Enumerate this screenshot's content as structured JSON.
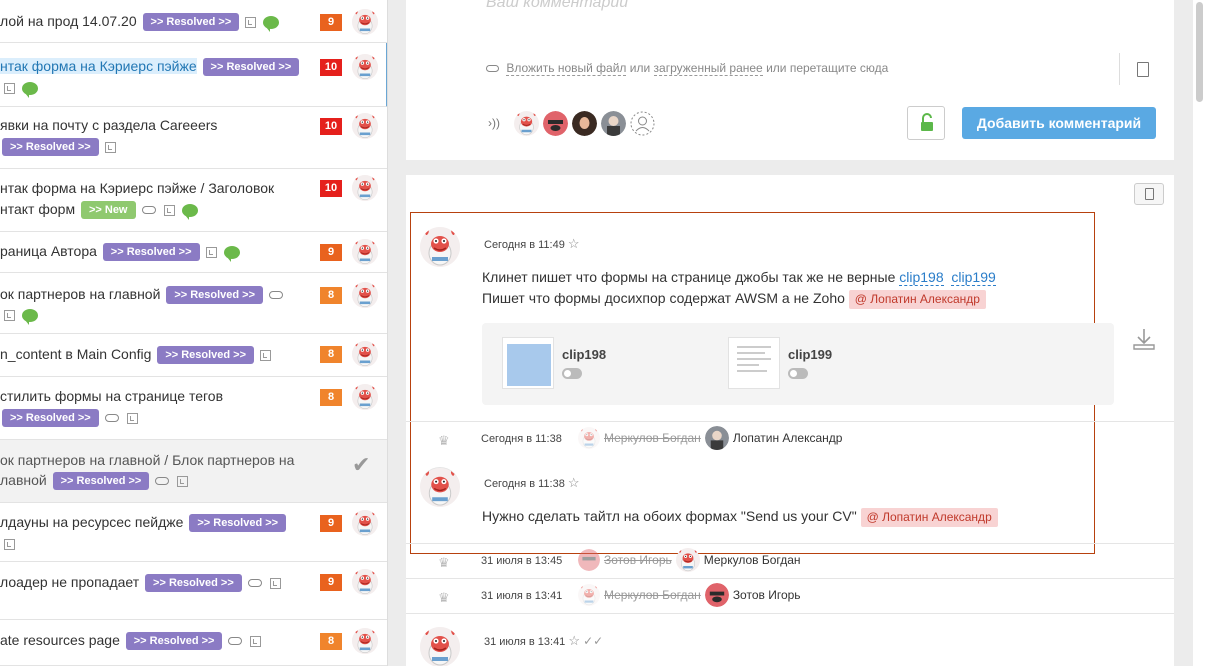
{
  "tasks": [
    {
      "title": "лой на прод 14.07.20",
      "badge": ">> Resolved >>",
      "prio": "9",
      "prio_color": "#e9621e"
    },
    {
      "title": "нтак форма на Кэриерс пэйже",
      "badge": ">> Resolved >>",
      "prio": "10",
      "prio_color": "#e5201c"
    },
    {
      "title": "явки на почту с раздела Careeers",
      "badge": ">> Resolved >>",
      "prio": "10",
      "prio_color": "#e5201c"
    },
    {
      "title": "нтак форма на Кэриерс пэйже / Заголовок",
      "title2": "нтакт форм",
      "badge": ">> New",
      "prio": "10",
      "prio_color": "#e5201c"
    },
    {
      "title": "раница Автора",
      "badge": ">> Resolved >>",
      "prio": "9",
      "prio_color": "#e9621e"
    },
    {
      "title": "ок партнеров на главной",
      "badge": ">> Resolved >>",
      "prio": "8",
      "prio_color": "#f0842c"
    },
    {
      "title": "n_content в Main Config",
      "badge": ">> Resolved >>",
      "prio": "8",
      "prio_color": "#f0842c"
    },
    {
      "title": "стилить формы на странице тегов",
      "badge": ">> Resolved >>",
      "prio": "8",
      "prio_color": "#f0842c"
    },
    {
      "title": "ок партнеров на главной / Блок партнеров на",
      "title2": "лавной",
      "badge": ">> Resolved >>"
    },
    {
      "title": "лдауны на ресурсес пейдже",
      "badge": ">> Resolved >>",
      "prio": "9",
      "prio_color": "#e9621e"
    },
    {
      "title": "лоадер не пропадает",
      "badge": ">> Resolved >>",
      "prio": "9",
      "prio_color": "#e9621e"
    },
    {
      "title": "ate resources page",
      "badge": ">> Resolved >>",
      "prio": "8",
      "prio_color": "#f0842c"
    }
  ],
  "composer": {
    "placeholder": "Ваш комментарий",
    "attach_new": "Вложить новый файл",
    "or1": "или",
    "attach_prev": "загруженный ранее",
    "or2": "или",
    "drag": "перетащите сюда",
    "submit": "Добавить комментарий"
  },
  "comments": [
    {
      "time": "Сегодня в 11:49",
      "line1": "Клинет пишет что формы на странице джобы так же не верные",
      "link1": "clip198",
      "link2": "clip199",
      "line2": "Пишет что формы досихпор содержат  AWSM  а не Zoho",
      "mention": "@ Лопатин Александр",
      "files": [
        "clip198",
        "clip199"
      ]
    },
    {
      "time": "Сегодня в 11:38",
      "text": "Нужно сделать тайтл на обоих формах \"Send us your CV\"",
      "mention": "@ Лопатин Александр"
    },
    {
      "time": "31 июля в 13:41"
    }
  ],
  "history": [
    {
      "time": "Сегодня в 11:38",
      "from": "Меркулов Богдан",
      "to": "Лопатин Александр"
    },
    {
      "time": "31 июля в 13:45",
      "from": "Зотов Игорь",
      "to": "Меркулов Богдан"
    },
    {
      "time": "31 июля в 13:41",
      "from": "Меркулов Богдан",
      "to": "Зотов Игорь"
    }
  ],
  "colors": {
    "accent": "#5aa9e3",
    "resolved": "#8b7bc4",
    "new": "#8fc96f",
    "highlight_border": "#b7410e",
    "mention_bg": "#f8d3d3"
  }
}
